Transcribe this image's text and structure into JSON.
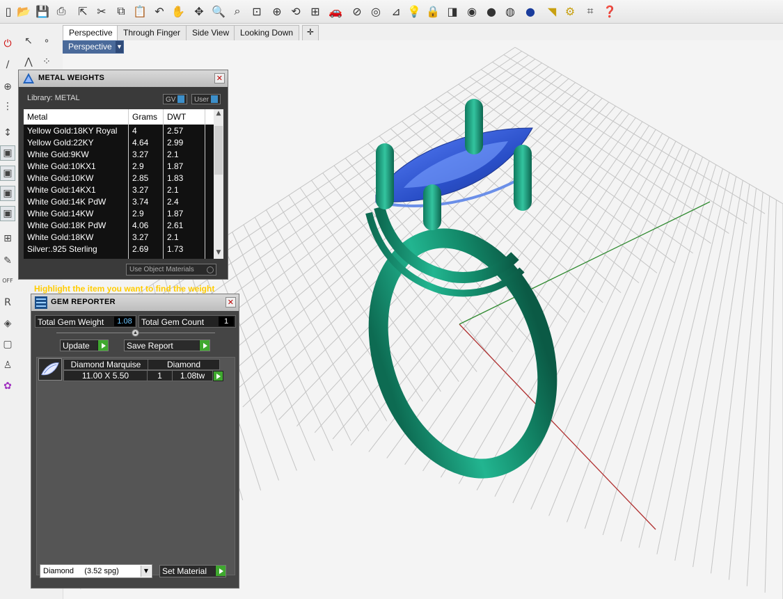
{
  "tabs": [
    {
      "label": "Perspective",
      "active": true
    },
    {
      "label": "Through Finger",
      "active": false
    },
    {
      "label": "Side View",
      "active": false
    },
    {
      "label": "Looking Down",
      "active": false
    }
  ],
  "viewport": {
    "label": "Perspective"
  },
  "metal_panel": {
    "title": "METAL WEIGHTS",
    "library": "Library: METAL",
    "gv_label": "GV",
    "user_label": "User",
    "columns": {
      "metal": "Metal",
      "grams": "Grams",
      "dwt": "DWT"
    },
    "rows": [
      {
        "metal": "Yellow Gold:18KY Royal",
        "grams": "4",
        "dwt": "2.57"
      },
      {
        "metal": "Yellow Gold:22KY",
        "grams": "4.64",
        "dwt": "2.99"
      },
      {
        "metal": "White Gold:9KW",
        "grams": "3.27",
        "dwt": "2.1"
      },
      {
        "metal": "White Gold:10KX1",
        "grams": "2.9",
        "dwt": "1.87"
      },
      {
        "metal": "White Gold:10KW",
        "grams": "2.85",
        "dwt": "1.83"
      },
      {
        "metal": "White Gold:14KX1",
        "grams": "3.27",
        "dwt": "2.1"
      },
      {
        "metal": "White Gold:14K PdW",
        "grams": "3.74",
        "dwt": "2.4"
      },
      {
        "metal": "White Gold:14KW",
        "grams": "2.9",
        "dwt": "1.87"
      },
      {
        "metal": "White Gold:18K PdW",
        "grams": "4.06",
        "dwt": "2.61"
      },
      {
        "metal": "White Gold:18KW",
        "grams": "3.27",
        "dwt": "2.1"
      },
      {
        "metal": "Silver:.925 Sterling",
        "grams": "2.69",
        "dwt": "1.73"
      }
    ],
    "use_object_materials": "Use Object Materials",
    "hint": "Highlight the item you want to find the weight"
  },
  "gem_panel": {
    "title": "GEM REPORTER",
    "total_weight_label": "Total Gem Weight",
    "total_weight_value": "1.08",
    "total_count_label": "Total Gem Count",
    "total_count_value": "1",
    "update_label": "Update",
    "save_report_label": "Save Report",
    "gems": [
      {
        "shape": "Diamond Marquise",
        "material": "Diamond",
        "size": "11.00 X 5.50",
        "count": "1",
        "weight": "1.08tw"
      }
    ],
    "material_select": "Diamond     (3.52 spg)",
    "set_material_label": "Set Material"
  },
  "colors": {
    "band": "#1aa07e",
    "gem": "#3a64d8",
    "grid": "#c4c4c4",
    "axis_x": "#b03030",
    "axis_y": "#2f8a2f",
    "hint": "#ffcc00"
  }
}
